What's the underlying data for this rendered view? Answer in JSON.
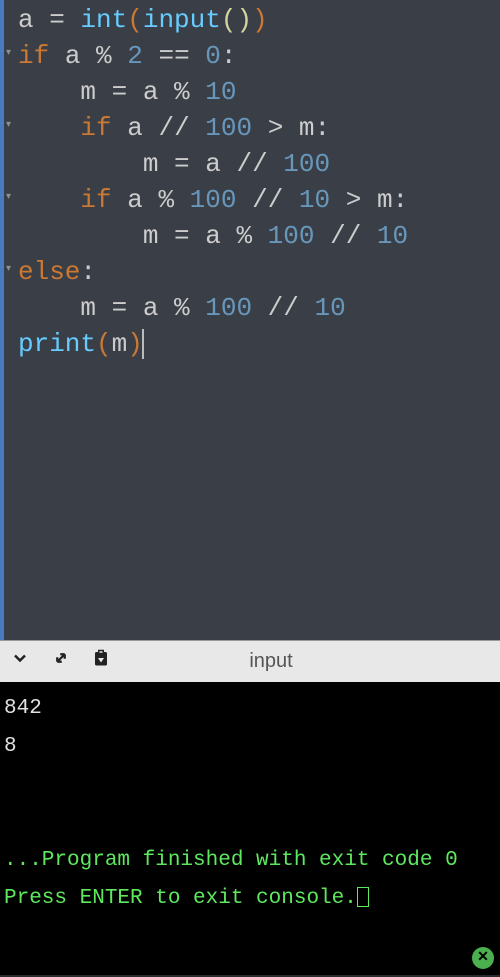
{
  "code": {
    "line1": {
      "a": "a",
      "eq": " = ",
      "int": "int",
      "p1": "(",
      "input": "input",
      "p2": "(",
      "p3": ")",
      "p4": ")"
    },
    "line2": {
      "if": "if",
      "sp": " ",
      "a": "a",
      "mod": " % ",
      "n2": "2",
      "eqeq": " == ",
      "n0": "0",
      "colon": ":"
    },
    "line3": {
      "indent": "    ",
      "m": "m",
      "eq": " = ",
      "a": "a",
      "mod": " % ",
      "n10": "10"
    },
    "line4": {
      "indent": "    ",
      "if": "if",
      "sp": " ",
      "a": "a",
      "div": " // ",
      "n100": "100",
      "gt": " > ",
      "m": "m",
      "colon": ":"
    },
    "line5": {
      "indent": "        ",
      "m": "m",
      "eq": " = ",
      "a": "a",
      "div": " // ",
      "n100": "100"
    },
    "line6": {
      "indent": "    ",
      "if": "if",
      "sp": " ",
      "a": "a",
      "mod": " % ",
      "n100": "100",
      "div": " // ",
      "n10": "10",
      "gt": " > ",
      "m": "m",
      "colon": ":"
    },
    "line7": {
      "indent": "        ",
      "m": "m",
      "eq": " = ",
      "a": "a",
      "mod": " % ",
      "n100": "100",
      "div": " // ",
      "n10": "10"
    },
    "line8": {
      "else": "else",
      "colon": ":"
    },
    "line9": {
      "indent": "    ",
      "m": "m",
      "eq": " = ",
      "a": "a",
      "mod": " % ",
      "n100": "100",
      "div": " // ",
      "n10": "10"
    },
    "line10": {
      "print": "print",
      "p1": "(",
      "m": "m",
      "p2": ")"
    }
  },
  "console_header": {
    "label": "input"
  },
  "console": {
    "input": "842",
    "output": "8",
    "finished": "...Program finished with exit code 0",
    "prompt": "Press ENTER to exit console."
  }
}
